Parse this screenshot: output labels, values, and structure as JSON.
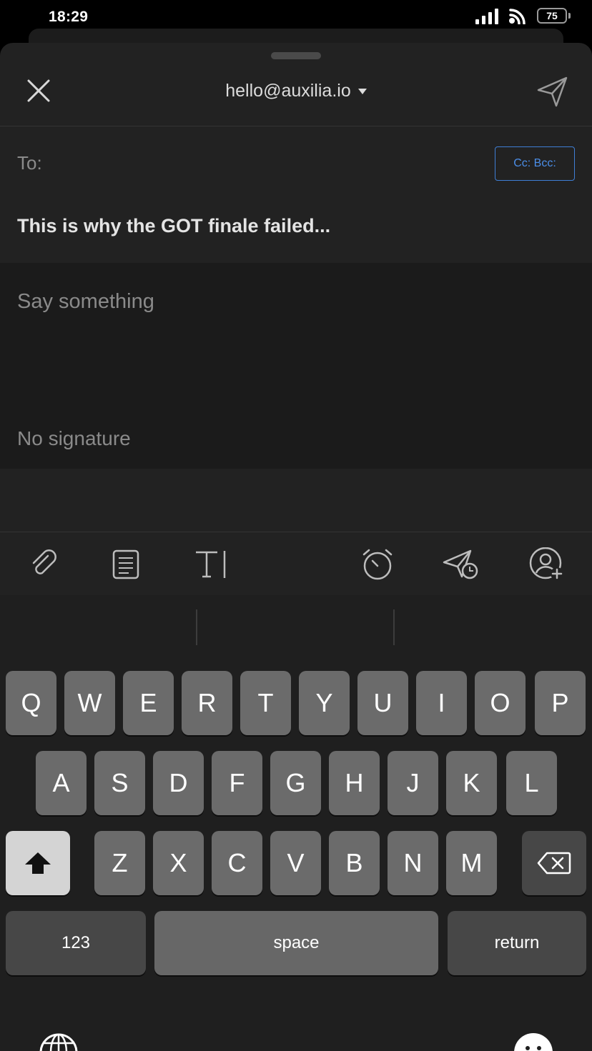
{
  "status_bar": {
    "time": "18:29",
    "battery": "75"
  },
  "header": {
    "from_account": "hello@auxilia.io"
  },
  "fields": {
    "to_label": "To:",
    "cc_bcc_label": "Cc: Bcc:",
    "subject": "This is why the GOT finale failed...",
    "body_placeholder": "Say something",
    "signature": "No signature"
  },
  "toolbar": {
    "icons": [
      "paperclip-icon",
      "template-icon",
      "text-format-icon",
      "alarm-clock-icon",
      "send-later-icon",
      "add-contact-icon"
    ]
  },
  "keyboard": {
    "row1": [
      "Q",
      "W",
      "E",
      "R",
      "T",
      "Y",
      "U",
      "I",
      "O",
      "P"
    ],
    "row2": [
      "A",
      "S",
      "D",
      "F",
      "G",
      "H",
      "J",
      "K",
      "L"
    ],
    "row3": [
      "Z",
      "X",
      "C",
      "V",
      "B",
      "N",
      "M"
    ],
    "numbers_label": "123",
    "space_label": "space",
    "return_label": "return"
  },
  "colors": {
    "background": "#222222",
    "body_background": "#1b1b1b",
    "accent_blue": "#4b8ee8",
    "key": "#6b6b6b",
    "key_dark": "#474747"
  }
}
